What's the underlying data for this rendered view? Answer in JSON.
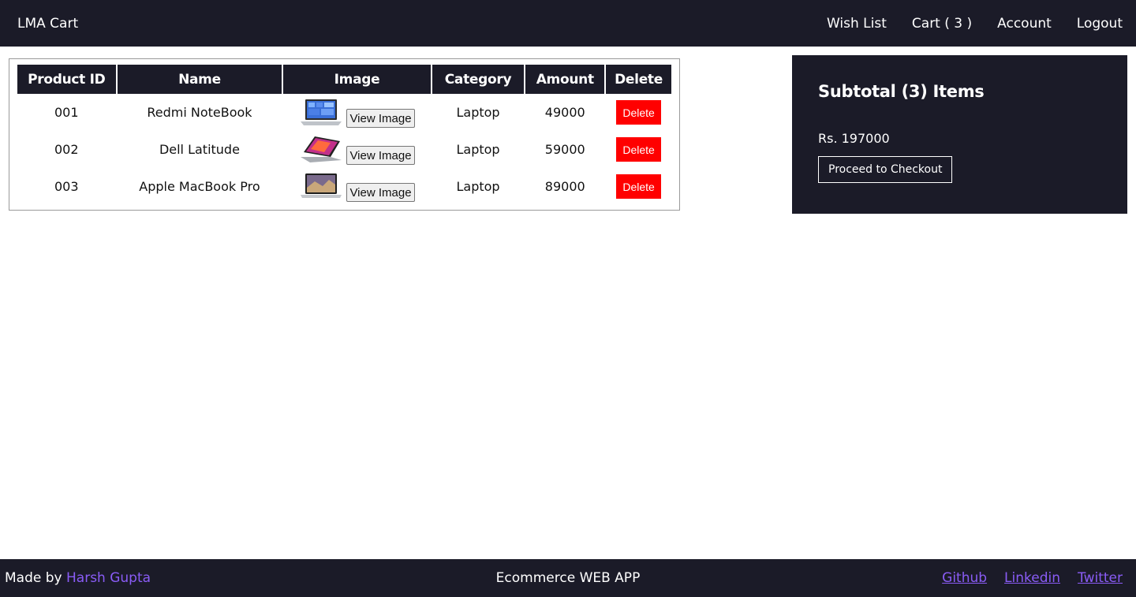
{
  "navbar": {
    "brand": "LMA Cart",
    "links": [
      "Wish List",
      "Cart ( 3 )",
      "Account",
      "Logout"
    ]
  },
  "cart_table": {
    "headers": [
      "Product ID",
      "Name",
      "Image",
      "Category",
      "Amount",
      "Delete"
    ],
    "rows": [
      {
        "id": "001",
        "name": "Redmi NoteBook",
        "image_button": "View Image",
        "category": "Laptop",
        "amount": "49000",
        "delete_label": "Delete",
        "thumb_icon": "laptop-windows-icon"
      },
      {
        "id": "002",
        "name": "Dell Latitude",
        "image_button": "View Image",
        "category": "Laptop",
        "amount": "59000",
        "delete_label": "Delete",
        "thumb_icon": "laptop-convertible-icon"
      },
      {
        "id": "003",
        "name": "Apple MacBook Pro",
        "image_button": "View Image",
        "category": "Laptop",
        "amount": "89000",
        "delete_label": "Delete",
        "thumb_icon": "laptop-macbook-icon"
      }
    ]
  },
  "subtotal": {
    "title": "Subtotal (3) Items",
    "amount": "Rs. 197000",
    "checkout_label": "Proceed to Checkout"
  },
  "footer": {
    "made_by_prefix": "Made by ",
    "author": "Harsh Gupta",
    "center_text": "Ecommerce WEB APP",
    "social": [
      "Github",
      "Linkedin",
      "Twitter"
    ]
  },
  "colors": {
    "dark": "#1b1b28",
    "delete_red": "#ff0000",
    "link_purple": "#8a5cf6"
  }
}
